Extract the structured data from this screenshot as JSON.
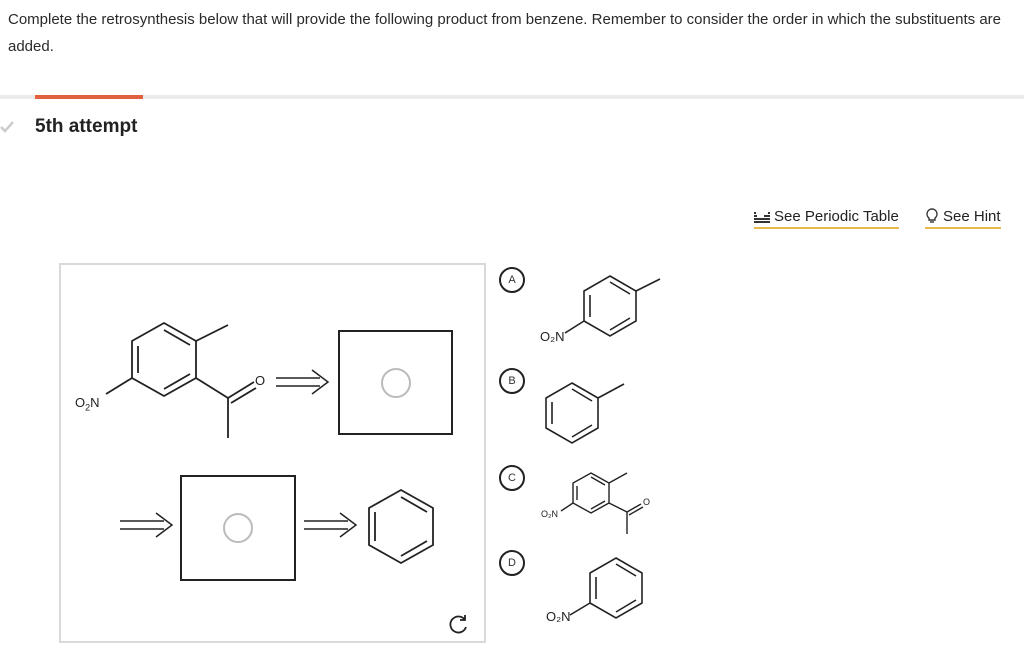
{
  "question": {
    "text": "Complete the retrosynthesis below that will provide the following product from benzene. Remember to consider the order in which the substituents are added."
  },
  "attempt": {
    "label": "5th attempt"
  },
  "tools": {
    "periodic_table": "See Periodic Table",
    "hint": "See Hint",
    "periodic_icon": "periodic-table-icon",
    "hint_icon": "lightbulb-icon"
  },
  "workspace": {
    "product_group_label": "O2N",
    "carbonyl_o": "O"
  },
  "choices": [
    {
      "letter": "A",
      "group_label": "O₂N"
    },
    {
      "letter": "B"
    },
    {
      "letter": "C",
      "group_label": "O₂N",
      "carbonyl_o": "O"
    },
    {
      "letter": "D",
      "group_label": "O₂N"
    }
  ],
  "colors": {
    "accent_bar": "#e06040",
    "link_underline": "#e8b84a",
    "workspace_border": "#d9d9d9"
  }
}
